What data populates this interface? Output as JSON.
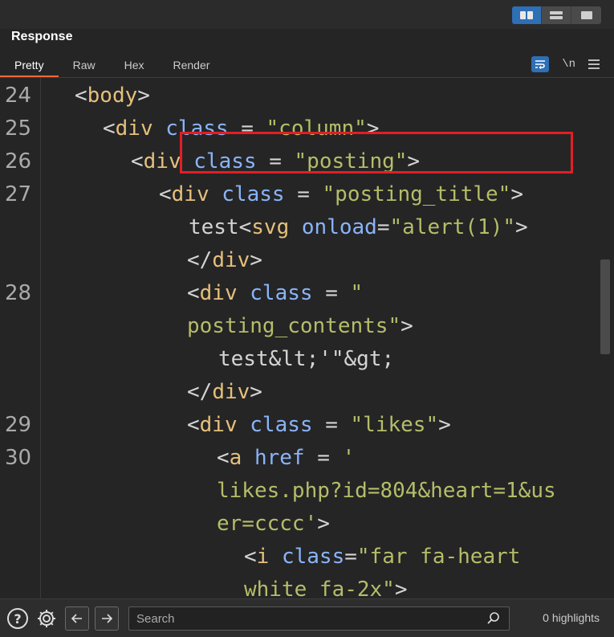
{
  "panel": {
    "title": "Response"
  },
  "tabs": [
    {
      "label": "Pretty",
      "active": true
    },
    {
      "label": "Raw",
      "active": false
    },
    {
      "label": "Hex",
      "active": false
    },
    {
      "label": "Render",
      "active": false
    }
  ],
  "tools": {
    "newline_label": "\\n"
  },
  "code": {
    "rows": [
      {
        "ln": "24",
        "tokens": [
          [
            "t-punct",
            "<"
          ],
          [
            "t-tag",
            "body"
          ],
          [
            "t-punct",
            ">"
          ]
        ]
      },
      {
        "ln": "25",
        "tokens": [
          [
            "t-punct",
            "<"
          ],
          [
            "t-tag",
            "div"
          ],
          [
            "t-punct",
            " "
          ],
          [
            "t-attr",
            "class"
          ],
          [
            "t-punct",
            " = "
          ],
          [
            "t-str",
            "\"column\""
          ],
          [
            "t-punct",
            ">"
          ]
        ]
      },
      {
        "ln": "26",
        "tokens": [
          [
            "t-punct",
            "<"
          ],
          [
            "t-tag",
            "div"
          ],
          [
            "t-punct",
            " "
          ],
          [
            "t-attr",
            "class"
          ],
          [
            "t-punct",
            " = "
          ],
          [
            "t-str",
            "\"posting\""
          ],
          [
            "t-punct",
            ">"
          ]
        ]
      },
      {
        "ln": "27",
        "tokens": [
          [
            "t-punct",
            "<"
          ],
          [
            "t-tag",
            "div"
          ],
          [
            "t-punct",
            " "
          ],
          [
            "t-attr",
            "class"
          ],
          [
            "t-punct",
            " = "
          ],
          [
            "t-str",
            "\"posting_title\""
          ],
          [
            "t-punct",
            ">"
          ]
        ]
      },
      {
        "ln": "",
        "tokens": [
          [
            "t-text",
            "test"
          ],
          [
            "t-punct",
            "<"
          ],
          [
            "t-tag",
            "svg"
          ],
          [
            "t-punct",
            " "
          ],
          [
            "t-attr",
            "onload"
          ],
          [
            "t-punct",
            "="
          ],
          [
            "t-str",
            "\"alert(1)\""
          ],
          [
            "t-punct",
            ">"
          ]
        ]
      },
      {
        "ln": "",
        "tokens": [
          [
            "t-punct",
            "</"
          ],
          [
            "t-tag",
            "div"
          ],
          [
            "t-punct",
            ">"
          ]
        ]
      },
      {
        "ln": "28",
        "tokens": [
          [
            "t-punct",
            "<"
          ],
          [
            "t-tag",
            "div"
          ],
          [
            "t-punct",
            " "
          ],
          [
            "t-attr",
            "class"
          ],
          [
            "t-punct",
            " = "
          ],
          [
            "t-str",
            "\""
          ]
        ]
      },
      {
        "ln": "",
        "tokens": [
          [
            "t-str",
            "posting_contents\""
          ],
          [
            "t-punct",
            ">"
          ]
        ]
      },
      {
        "ln": "",
        "tokens": [
          [
            "t-text",
            "test&lt;'\"&gt;"
          ]
        ]
      },
      {
        "ln": "",
        "tokens": [
          [
            "t-punct",
            "</"
          ],
          [
            "t-tag",
            "div"
          ],
          [
            "t-punct",
            ">"
          ]
        ]
      },
      {
        "ln": "29",
        "tokens": [
          [
            "t-punct",
            "<"
          ],
          [
            "t-tag",
            "div"
          ],
          [
            "t-punct",
            " "
          ],
          [
            "t-attr",
            "class"
          ],
          [
            "t-punct",
            " = "
          ],
          [
            "t-str",
            "\"likes\""
          ],
          [
            "t-punct",
            ">"
          ]
        ]
      },
      {
        "ln": "30",
        "tokens": [
          [
            "t-punct",
            "<"
          ],
          [
            "t-tag",
            "a"
          ],
          [
            "t-punct",
            " "
          ],
          [
            "t-attr",
            "href"
          ],
          [
            "t-punct",
            " = "
          ],
          [
            "t-str",
            "'"
          ]
        ]
      },
      {
        "ln": "",
        "tokens": [
          [
            "t-str",
            "likes.php?id=804&heart=1&us"
          ]
        ]
      },
      {
        "ln": "",
        "tokens": [
          [
            "t-str",
            "er=cccc'"
          ],
          [
            "t-punct",
            ">"
          ]
        ]
      },
      {
        "ln": "",
        "tokens": [
          [
            "t-punct",
            "<"
          ],
          [
            "t-tag",
            "i"
          ],
          [
            "t-punct",
            " "
          ],
          [
            "t-attr",
            "class"
          ],
          [
            "t-punct",
            "="
          ],
          [
            "t-str",
            "\"far fa-heart"
          ]
        ]
      },
      {
        "ln": "",
        "tokens": [
          [
            "t-str",
            "white fa-2x\""
          ],
          [
            "t-punct",
            ">"
          ]
        ]
      }
    ]
  },
  "bottom": {
    "search_placeholder": "Search",
    "highlights_label": "0 highlights"
  },
  "colors": {
    "accent": "#2e6fb5",
    "tab_underline": "#ff6633",
    "highlight_box": "#e31e24"
  },
  "icons": [
    "layout-columns-icon",
    "layout-rows-icon",
    "layout-single-icon",
    "wrap-lines-icon",
    "menu-icon",
    "help-icon",
    "gear-icon",
    "arrow-left-icon",
    "arrow-right-icon",
    "search-icon"
  ]
}
